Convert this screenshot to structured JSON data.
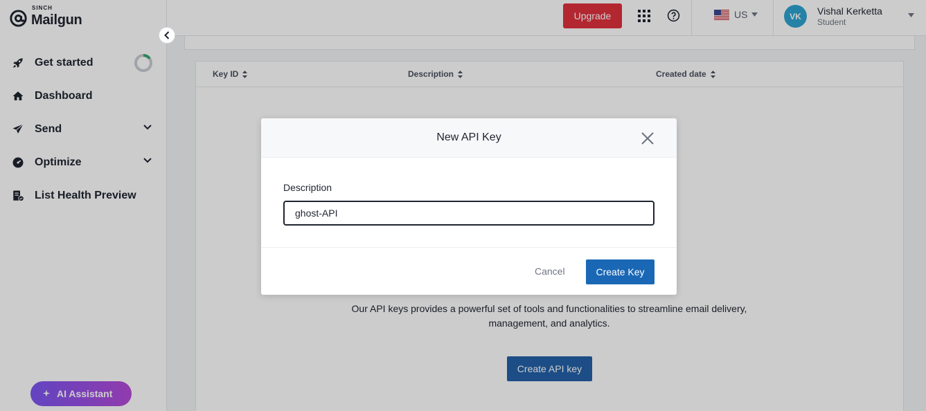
{
  "brand": {
    "sinch": "SINCH",
    "name": "Mailgun"
  },
  "sidebar": {
    "items": [
      {
        "label": "Get started",
        "icon": "rocket-icon",
        "progress_fraction": 0.15
      },
      {
        "label": "Dashboard",
        "icon": "home-icon"
      },
      {
        "label": "Send",
        "icon": "paper-plane-icon",
        "expandable": true
      },
      {
        "label": "Optimize",
        "icon": "gauge-icon",
        "expandable": true
      },
      {
        "label": "List Health Preview",
        "icon": "list-check-icon"
      }
    ],
    "ai_assistant_label": "AI Assistant"
  },
  "topbar": {
    "upgrade_label": "Upgrade",
    "region": "US",
    "user": {
      "initials": "VK",
      "name": "Vishal Kerketta",
      "role": "Student"
    }
  },
  "table": {
    "columns": [
      "Key ID",
      "Description",
      "Created date"
    ]
  },
  "empty_state": {
    "text": "Our API keys provides a powerful set of tools and functionalities to streamline email delivery, management, and analytics.",
    "button_label": "Create API key"
  },
  "modal": {
    "title": "New API Key",
    "field_label": "Description",
    "field_value": "ghost-API",
    "cancel_label": "Cancel",
    "submit_label": "Create Key"
  },
  "colors": {
    "upgrade": "#e0313d",
    "primary": "#1a68b5",
    "avatar": "#2ea3d0",
    "ai_gradient_start": "#7b56f2",
    "ai_gradient_end": "#b54bd8"
  }
}
